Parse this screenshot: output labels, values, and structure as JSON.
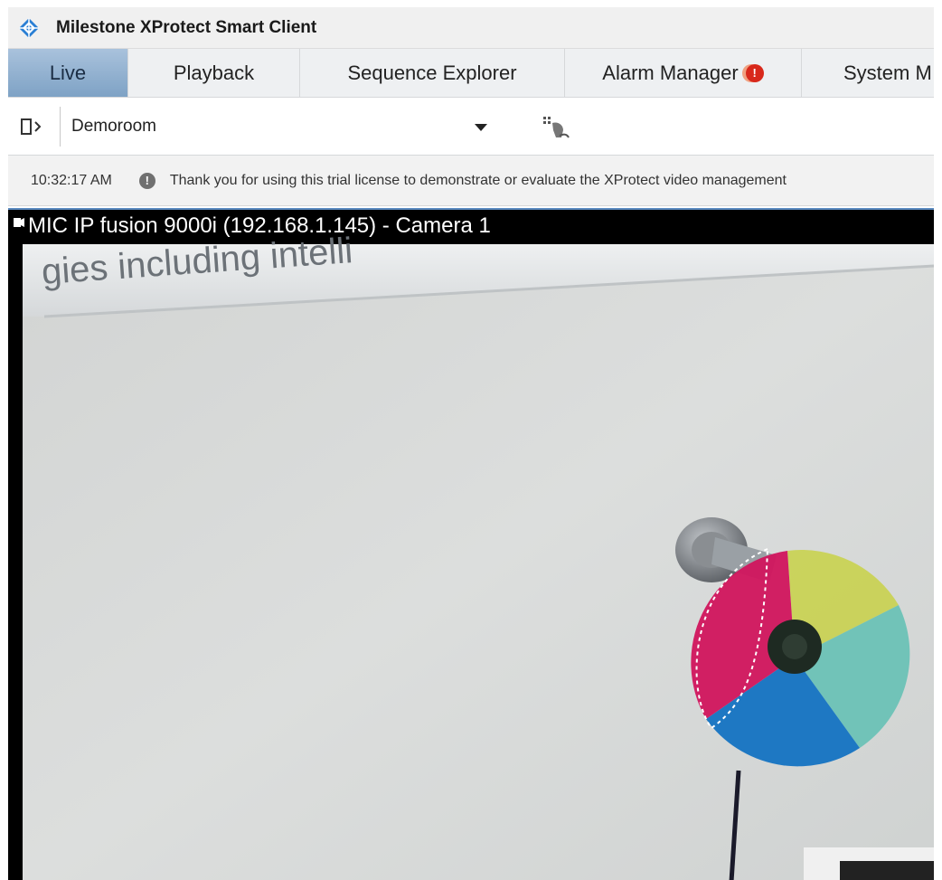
{
  "app": {
    "title": "Milestone XProtect Smart Client",
    "logo_icon": "milestone-logo-icon"
  },
  "tabs": [
    {
      "label": "Live",
      "active": true
    },
    {
      "label": "Playback",
      "active": false
    },
    {
      "label": "Sequence Explorer",
      "active": false
    },
    {
      "label": "Alarm Manager",
      "active": false,
      "badge": "!"
    },
    {
      "label": "System M",
      "active": false
    }
  ],
  "toolbar": {
    "pane_toggle_icon": "pane-toggle-icon",
    "selected_view": "Demoroom",
    "setup_icon": "setup-hand-icon"
  },
  "status": {
    "time": "10:32:17 AM",
    "message": "Thank you for using this trial license to demonstrate or evaluate the XProtect video management"
  },
  "camera": {
    "title": "MIC IP fusion 9000i (192.168.1.145) - Camera 1",
    "overlay_text": "gies including intelli"
  },
  "colors": {
    "active_tab": "#7ea2c5",
    "badge": "#d8281b",
    "camera_border": "#5b8ac0"
  }
}
